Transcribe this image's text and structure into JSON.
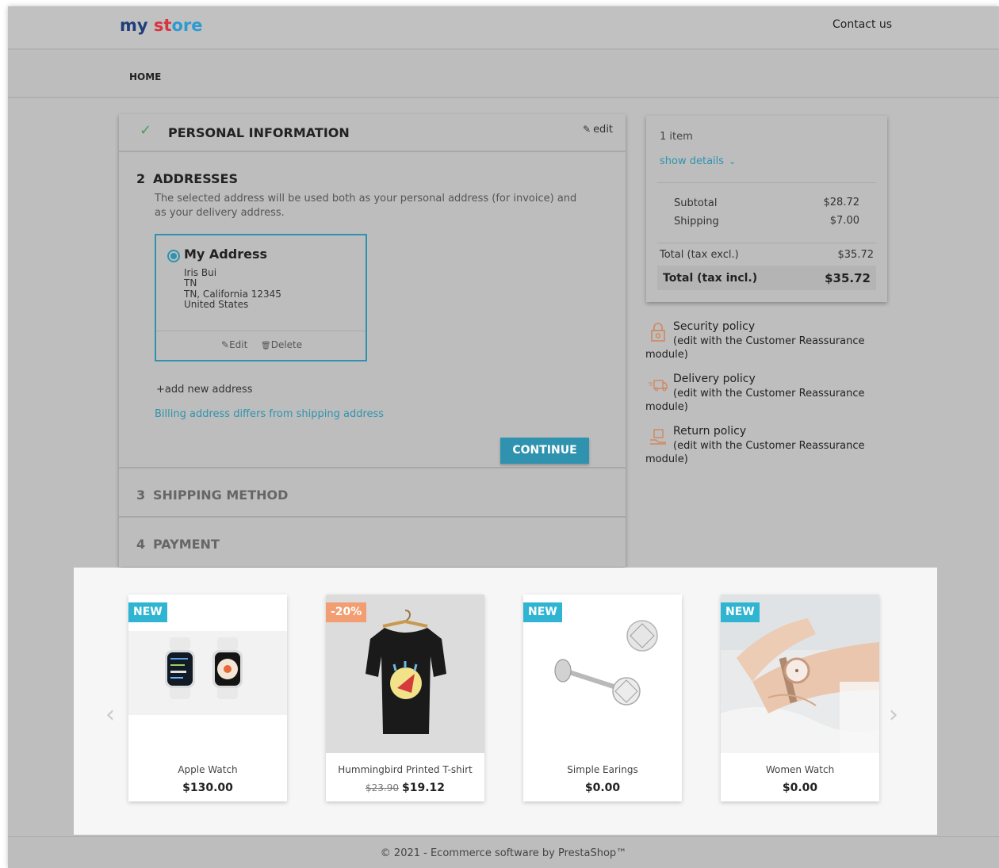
{
  "header": {
    "logo": {
      "part1": "my",
      "part2": " st",
      "part3": "ore"
    },
    "contact_label": "Contact us"
  },
  "breadcrumb": {
    "home": "HOME"
  },
  "checkout": {
    "personal": {
      "title": "PERSONAL INFORMATION",
      "edit_label": "edit"
    },
    "addresses": {
      "number": "2",
      "title": "ADDRESSES",
      "description": "The selected address will be used both as your personal address (for invoice) and as your delivery address.",
      "card": {
        "alias": "My Address",
        "lines": [
          "Iris Bui",
          "TN",
          "TN, California 12345",
          "United States"
        ],
        "edit_label": "Edit",
        "delete_label": "Delete"
      },
      "add_new_label": "add new address",
      "billing_link": "Billing address differs from shipping address",
      "continue_label": "CONTINUE"
    },
    "shipping": {
      "number": "3",
      "title": "SHIPPING METHOD"
    },
    "payment": {
      "number": "4",
      "title": "PAYMENT"
    }
  },
  "summary": {
    "item_count": "1 item",
    "show_details": "show details",
    "subtotal_label": "Subtotal",
    "subtotal_value": "$28.72",
    "shipping_label": "Shipping",
    "shipping_value": "$7.00",
    "total_excl_label": "Total (tax excl.)",
    "total_excl_value": "$35.72",
    "total_incl_label": "Total (tax incl.)",
    "total_incl_value": "$35.72"
  },
  "reassurance": [
    {
      "title": "Security policy",
      "sub": "(edit with the Customer Reassurance",
      "sub2": "module)",
      "icon": "lock-icon"
    },
    {
      "title": "Delivery policy",
      "sub": "(edit with the Customer Reassurance",
      "sub2": "module)",
      "icon": "truck-icon"
    },
    {
      "title": "Return policy",
      "sub": "(edit with the Customer Reassurance",
      "sub2": "module)",
      "icon": "return-box-icon"
    }
  ],
  "products": [
    {
      "flag": "NEW",
      "name": "Apple Watch",
      "price": "$130.00",
      "old_price": ""
    },
    {
      "flag": "-20%",
      "name": "Hummingbird Printed T-shirt",
      "price": "$19.12",
      "old_price": "$23.90"
    },
    {
      "flag": "NEW",
      "name": "Simple Earings",
      "price": "$0.00",
      "old_price": ""
    },
    {
      "flag": "NEW",
      "name": "Women Watch",
      "price": "$0.00",
      "old_price": ""
    }
  ],
  "footer": {
    "copyright": "© 2021 - Ecommerce software by PrestaShop™"
  },
  "colors": {
    "accent": "#2f93af",
    "flag_new": "#2fb5d2",
    "flag_discount": "#f39d72",
    "check": "#4a9b5d"
  }
}
